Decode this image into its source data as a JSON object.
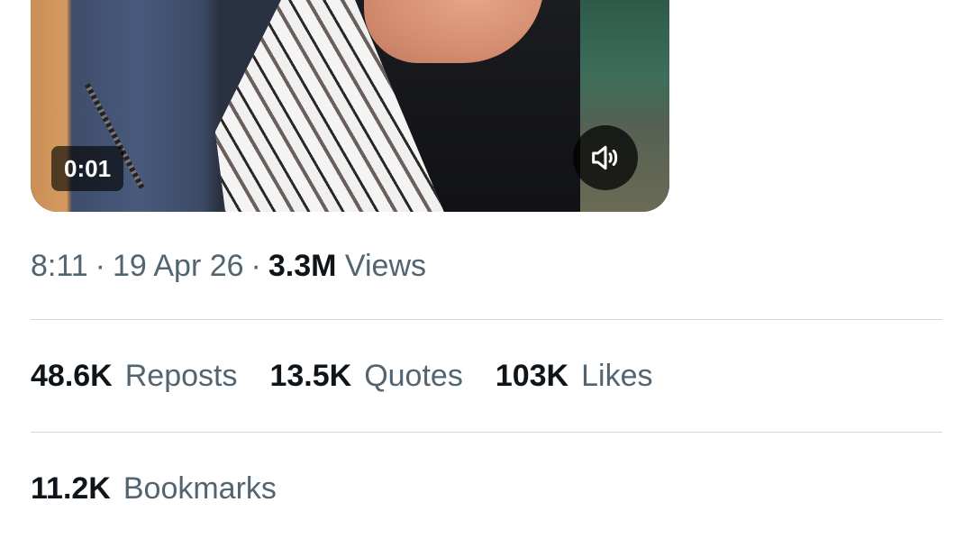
{
  "video": {
    "elapsed": "0:01",
    "mute_icon": "speaker-icon"
  },
  "meta": {
    "time": "8:11",
    "separator": "·",
    "date": "19 Apr 26",
    "views_count": "3.3M",
    "views_label": "Views"
  },
  "stats": {
    "reposts_count": "48.6K",
    "reposts_label": "Reposts",
    "quotes_count": "13.5K",
    "quotes_label": "Quotes",
    "likes_count": "103K",
    "likes_label": "Likes",
    "bookmarks_count": "11.2K",
    "bookmarks_label": "Bookmarks"
  },
  "colors": {
    "primary_text": "#0f1419",
    "secondary_text": "#536471",
    "divider": "#cfd9de"
  }
}
